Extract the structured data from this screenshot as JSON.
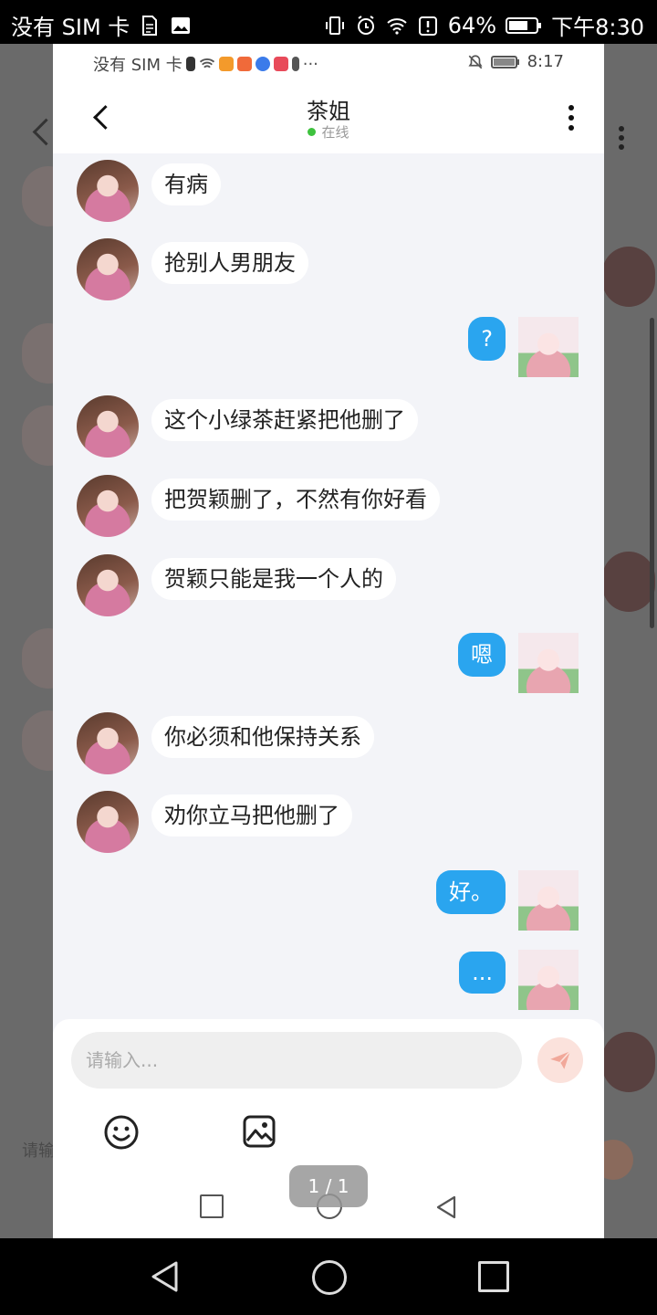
{
  "outer_status": {
    "carrier": "没有 SIM 卡",
    "battery": "64%",
    "time": "下午8:30"
  },
  "background_app": {
    "input_hint": "请输"
  },
  "inner_status": {
    "carrier": "没有 SIM 卡",
    "time": "8:17"
  },
  "header": {
    "title": "茶姐",
    "status": "在线"
  },
  "messages": [
    {
      "side": "left",
      "text": "有病"
    },
    {
      "side": "left",
      "text": "抢别人男朋友"
    },
    {
      "side": "right",
      "text": "?"
    },
    {
      "side": "left",
      "text": "这个小绿茶赶紧把他删了"
    },
    {
      "side": "left",
      "text": "把贺颖删了，不然有你好看"
    },
    {
      "side": "left",
      "text": "贺颖只能是我一个人的"
    },
    {
      "side": "right",
      "text": "嗯"
    },
    {
      "side": "left",
      "text": "你必须和他保持关系"
    },
    {
      "side": "left",
      "text": "劝你立马把他删了"
    },
    {
      "side": "right",
      "text": "好。"
    },
    {
      "side": "right",
      "text": "..."
    }
  ],
  "composer": {
    "placeholder": "请输入...",
    "send_color": "#f1a89a"
  },
  "page_indicator": "1 / 1",
  "colors": {
    "accent_bubble": "#2aa5ef",
    "online_dot": "#3ec23e"
  }
}
